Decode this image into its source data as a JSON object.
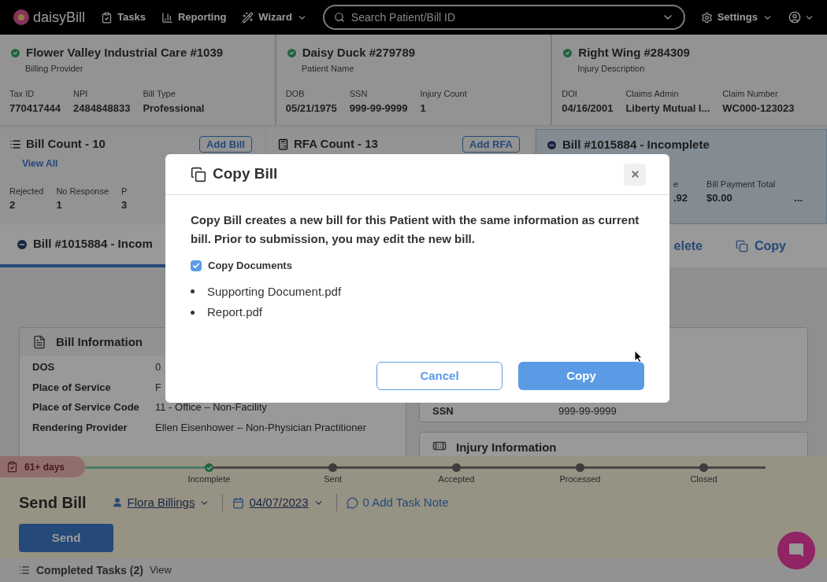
{
  "nav": {
    "logo": "daisyBill",
    "items": [
      {
        "label": "Tasks",
        "kind": "tasks"
      },
      {
        "label": "Reporting",
        "kind": "reporting"
      },
      {
        "label": "Wizard",
        "kind": "wizard"
      }
    ],
    "search": {
      "placeholder": "Search Patient/Bill ID"
    },
    "settings": "Settings"
  },
  "summary_cards": [
    {
      "title": "Flower Valley Industrial Care #1039",
      "subtitle": "Billing Provider",
      "verified": true,
      "fields": [
        {
          "label": "Tax ID",
          "value": "770417444"
        },
        {
          "label": "NPI",
          "value": "2484848833"
        },
        {
          "label": "Bill Type",
          "value": "Professional"
        }
      ]
    },
    {
      "title": "Daisy Duck #279789",
      "subtitle": "Patient Name",
      "verified": true,
      "fields": [
        {
          "label": "DOB",
          "value": "05/21/1975"
        },
        {
          "label": "SSN",
          "value": "999-99-9999"
        },
        {
          "label": "Injury Count",
          "value": "1"
        }
      ]
    },
    {
      "title": "Right Wing #284309",
      "subtitle": "Injury Description",
      "verified": true,
      "fields": [
        {
          "label": "DOI",
          "value": "04/16/2001"
        },
        {
          "label": "Claims Admin",
          "value": "Liberty Mutual I..."
        },
        {
          "label": "Claim Number",
          "value": "WC000-123023"
        }
      ]
    }
  ],
  "bill_count": {
    "title": "Bill Count - 10",
    "link": "View All",
    "button": "Add Bill",
    "stats": [
      {
        "label": "Rejected",
        "value": "2"
      },
      {
        "label": "No Response",
        "value": "1"
      },
      {
        "label": "P",
        "value": "3"
      }
    ]
  },
  "rfa_count": {
    "title": "RFA Count - 13",
    "button": "Add RFA"
  },
  "bill_card": {
    "title": "Bill #1015884 - Incomplete",
    "stats": [
      {
        "label": "e",
        "value": ".92"
      },
      {
        "label": "Bill Payment Total",
        "value": "$0.00"
      }
    ],
    "more": "..."
  },
  "bill_bar": {
    "title": "Bill #1015884 - Incom",
    "actions": [
      {
        "label": "elete",
        "kind": "delete"
      },
      {
        "label": "Copy",
        "kind": "copy"
      }
    ]
  },
  "bill_information": {
    "title": "Bill Information",
    "rows": [
      {
        "label": "DOS",
        "value": "0"
      },
      {
        "label": "Place of Service",
        "value": "F"
      },
      {
        "label": "Place of Service Code",
        "value": "11 - Office – Non-Facility"
      },
      {
        "label": "Rendering Provider",
        "value": "Ellen Eisenhower – Non-Physician Practitioner"
      }
    ]
  },
  "patient_panel": {
    "rows": [
      {
        "label": "SSN",
        "value": "999-99-9999"
      }
    ]
  },
  "injury_information": {
    "title": "Injury Information"
  },
  "timeline": {
    "badge": "61+ days",
    "steps": [
      {
        "label": "Incomplete",
        "done": true
      },
      {
        "label": "Sent",
        "done": false
      },
      {
        "label": "Accepted",
        "done": false
      },
      {
        "label": "Processed",
        "done": false
      },
      {
        "label": "Closed",
        "done": false
      }
    ]
  },
  "send_bill": {
    "title": "Send Bill",
    "assignee": "Flora Billings",
    "date": "04/07/2023",
    "note": "0 Add Task Note",
    "button": "Send"
  },
  "completed_tasks": {
    "label": "Completed Tasks (2)",
    "link": "View"
  },
  "modal": {
    "title": "Copy Bill",
    "text": "Copy Bill creates a new bill for this Patient with the same information as current bill. Prior to submission, you may edit the new bill.",
    "copy_documents": {
      "label": "Copy Documents",
      "checked": true
    },
    "documents": [
      "Supporting Document.pdf",
      "Report.pdf"
    ],
    "buttons": [
      {
        "label": "Cancel",
        "kind": "secondary"
      },
      {
        "label": "Copy",
        "kind": "primary"
      }
    ]
  }
}
